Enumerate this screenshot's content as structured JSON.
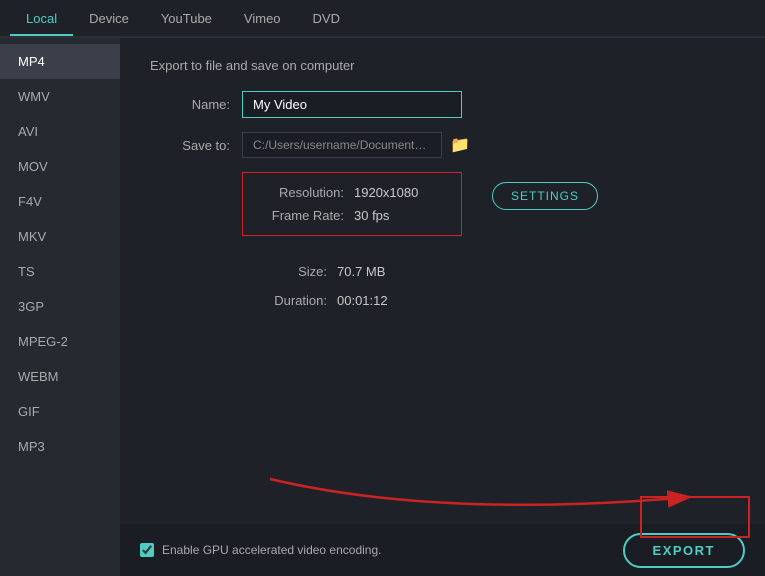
{
  "nav": {
    "tabs": [
      {
        "id": "local",
        "label": "Local",
        "active": true
      },
      {
        "id": "device",
        "label": "Device",
        "active": false
      },
      {
        "id": "youtube",
        "label": "YouTube",
        "active": false
      },
      {
        "id": "vimeo",
        "label": "Vimeo",
        "active": false
      },
      {
        "id": "dvd",
        "label": "DVD",
        "active": false
      }
    ]
  },
  "sidebar": {
    "items": [
      {
        "id": "mp4",
        "label": "MP4",
        "active": true
      },
      {
        "id": "wmv",
        "label": "WMV",
        "active": false
      },
      {
        "id": "avi",
        "label": "AVI",
        "active": false
      },
      {
        "id": "mov",
        "label": "MOV",
        "active": false
      },
      {
        "id": "f4v",
        "label": "F4V",
        "active": false
      },
      {
        "id": "mkv",
        "label": "MKV",
        "active": false
      },
      {
        "id": "ts",
        "label": "TS",
        "active": false
      },
      {
        "id": "3gp",
        "label": "3GP",
        "active": false
      },
      {
        "id": "mpeg2",
        "label": "MPEG-2",
        "active": false
      },
      {
        "id": "webm",
        "label": "WEBM",
        "active": false
      },
      {
        "id": "gif",
        "label": "GIF",
        "active": false
      },
      {
        "id": "mp3",
        "label": "MP3",
        "active": false
      }
    ]
  },
  "content": {
    "section_title": "Export to file and save on computer",
    "name_label": "Name:",
    "name_value": "My Video",
    "save_to_label": "Save to:",
    "save_to_value": "C:/...  /Documents/...",
    "resolution_label": "Resolution:",
    "resolution_value": "1920x1080",
    "frame_rate_label": "Frame Rate:",
    "frame_rate_value": "30 fps",
    "size_label": "Size:",
    "size_value": "70.7 MB",
    "duration_label": "Duration:",
    "duration_value": "00:01:12",
    "settings_label": "SETTINGS"
  },
  "bottom": {
    "gpu_label": "Enable GPU accelerated video encoding.",
    "export_label": "EXPORT"
  }
}
